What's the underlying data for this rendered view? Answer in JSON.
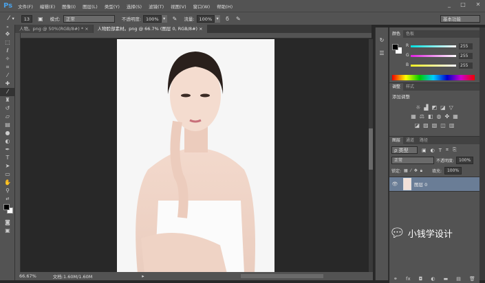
{
  "app": {
    "logo": "Ps",
    "window_controls": [
      "_",
      "□",
      "✕"
    ]
  },
  "menu": [
    "文件(F)",
    "编辑(E)",
    "图像(I)",
    "图层(L)",
    "类型(Y)",
    "选择(S)",
    "滤镜(T)",
    "视图(V)",
    "窗口(W)",
    "帮助(H)"
  ],
  "options": {
    "brush_size": "13",
    "mode_label": "模式:",
    "mode_value": "正常",
    "opacity_label": "不透明度:",
    "opacity_value": "100%",
    "flow_label": "流量:",
    "flow_value": "100%",
    "workspace": "基本功能"
  },
  "tabs": [
    {
      "label": "人物。png @ 50%(RGB/8#) *",
      "active": false
    },
    {
      "label": "人物脸部素材。png @ 66.7% (图层 0, RGB/8#)",
      "active": true
    }
  ],
  "status": {
    "zoom": "66.67%",
    "doc": "文档:1.60M/1.60M"
  },
  "color_panel": {
    "tabs": [
      "颜色",
      "色板"
    ],
    "channels": [
      {
        "name": "R",
        "value": "255",
        "color": "#00e0e0"
      },
      {
        "name": "G",
        "value": "255",
        "color": "#e020e0"
      },
      {
        "name": "B",
        "value": "255",
        "color": "#f0f020"
      }
    ]
  },
  "adjust_panel": {
    "tabs": [
      "调整",
      "样式"
    ],
    "title": "添加调整"
  },
  "layers_panel": {
    "tabs": [
      "图层",
      "通道",
      "路径"
    ],
    "filter": "ρ 类型",
    "blend": "正常",
    "opacity_label": "不透明度:",
    "opacity_value": "100%",
    "lock_label": "锁定:",
    "fill_label": "填充:",
    "fill_value": "100%",
    "layers": [
      {
        "name": "图层 0",
        "selected": true
      }
    ]
  },
  "watermark": "小钱学设计"
}
